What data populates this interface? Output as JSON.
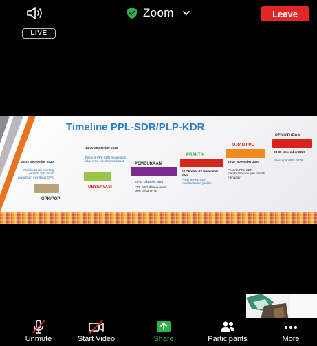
{
  "header": {
    "title": "Zoom",
    "leave_label": "Leave",
    "live_label": "LIVE",
    "colors": {
      "leave": "#e02828",
      "shield": "#2bb34a"
    }
  },
  "slide": {
    "title": "Timeline PPL-SDR/PLP-KDR",
    "steps": [
      {
        "label": "OPK/POP",
        "date": "26-27 September 2020",
        "desc": "Melalui zoom meeting peserta PPL-SDR diwajibkan mengikuti OPK"
      },
      {
        "label": "OBSERVASI",
        "date": "14-30 September 2020",
        "desc": "Peserta PPL-SDR melakukan observasi sekolah/madrasah"
      },
      {
        "label": "PEMBUKAAN",
        "date": "01-03 Oktober 2020",
        "desc": "PPL-SDR dibuka resmi oleh Dekan FTK"
      },
      {
        "label": "PRAKTIK",
        "date": "04 Oktober-22 November 2020",
        "desc": "Peserta PPL-SDR melaksanakan praktik"
      },
      {
        "label": "UJIAN PPL",
        "date": "23-27 November 2020",
        "desc": "Peserta PPL-SDR melaksanakan ujian praktik mengajar"
      },
      {
        "label": "PENUTUPAN",
        "date": "28-30 November 2020",
        "desc": "Penutupan PPL-SDR"
      }
    ]
  },
  "toolbar": {
    "unmute": "Unmute",
    "start_video": "Start Video",
    "share": "Share",
    "participants": "Participants",
    "more": "More"
  }
}
